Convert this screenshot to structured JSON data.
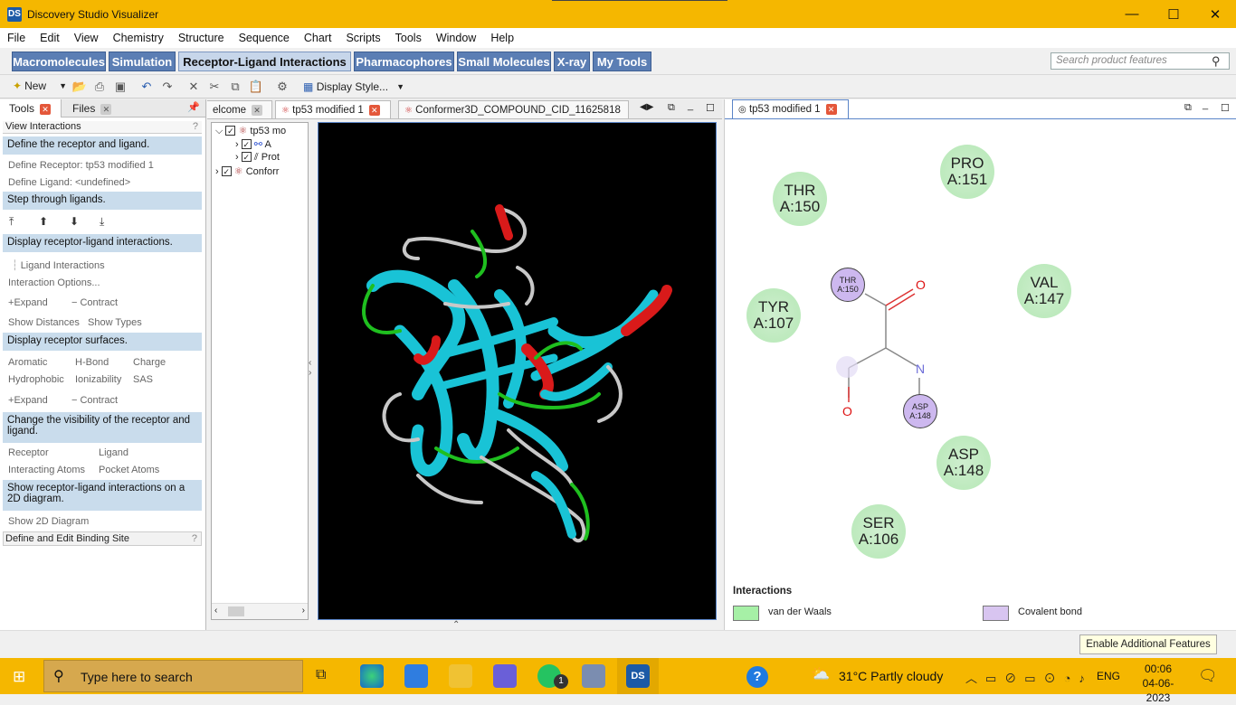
{
  "window": {
    "title": "Discovery Studio Visualizer"
  },
  "menu": [
    "File",
    "Edit",
    "View",
    "Chemistry",
    "Structure",
    "Sequence",
    "Chart",
    "Scripts",
    "Tools",
    "Window",
    "Help"
  ],
  "ribbon_tabs": [
    "Macromolecules",
    "Simulation",
    "Receptor-Ligand Interactions",
    "Pharmacophores",
    "Small Molecules",
    "X-ray",
    "My Tools"
  ],
  "search_placeholder": "Search product features",
  "toolbar": {
    "new_label": "New",
    "display_style_label": "Display Style..."
  },
  "left_tabs": {
    "tools": "Tools",
    "files": "Files"
  },
  "view_interactions": "View Interactions",
  "panel": {
    "define_head": "Define the receptor and ligand.",
    "define_receptor": "Define Receptor: tp53 modified 1",
    "define_ligand": "Define Ligand: <undefined>",
    "step_head": "Step through ligands.",
    "display_head": "Display receptor-ligand interactions.",
    "ligand_interactions": "Ligand Interactions",
    "interaction_options": "Interaction Options...",
    "expand": "Expand",
    "contract": "Contract",
    "show_distances": "Show Distances",
    "show_types": "Show Types",
    "surfaces_head": "Display receptor surfaces.",
    "aromatic": "Aromatic",
    "hbond": "H-Bond",
    "charge": "Charge",
    "hydrophobic": "Hydrophobic",
    "ionizability": "Ionizability",
    "sas": "SAS",
    "expand2": "Expand",
    "contract2": "Contract",
    "visibility_head": "Change the visibility of the receptor and ligand.",
    "receptor": "Receptor",
    "ligand": "Ligand",
    "interacting_atoms": "Interacting Atoms",
    "pocket_atoms": "Pocket Atoms",
    "diagram_head": "Show receptor-ligand interactions on a 2D diagram.",
    "show_2d": "Show 2D Diagram",
    "binding_site": "Define and Edit Binding Site"
  },
  "doc_tabs": [
    "elcome",
    "tp53 modified 1",
    "Conformer3D_COMPOUND_CID_11625818"
  ],
  "tree": [
    "tp53 mo",
    "A",
    "Prot",
    "Conforr"
  ],
  "right_tab": "tp53 modified 1",
  "residues": [
    {
      "name": "THR",
      "id": "A:150"
    },
    {
      "name": "PRO",
      "id": "A:151"
    },
    {
      "name": "VAL",
      "id": "A:147"
    },
    {
      "name": "TYR",
      "id": "A:107"
    },
    {
      "name": "ASP",
      "id": "A:148"
    },
    {
      "name": "SER",
      "id": "A:106"
    }
  ],
  "ligand_atoms": {
    "thr": "THR",
    "thr_id": "A:150",
    "asp": "ASP",
    "asp_id": "A:148",
    "o": "O",
    "n": "N"
  },
  "legend": {
    "title": "Interactions",
    "vdw": "van der Waals",
    "covalent": "Covalent bond",
    "vdw_color": "#a6f0a6",
    "covalent_color": "#d8c5f0"
  },
  "status": {
    "feature_btn": "Enable Additional Features"
  },
  "taskbar": {
    "search_placeholder": "Type here to search",
    "weather": "31°C  Partly cloudy",
    "lang": "ENG",
    "time": "00:06",
    "date": "04-06-2023",
    "badge": "1"
  }
}
